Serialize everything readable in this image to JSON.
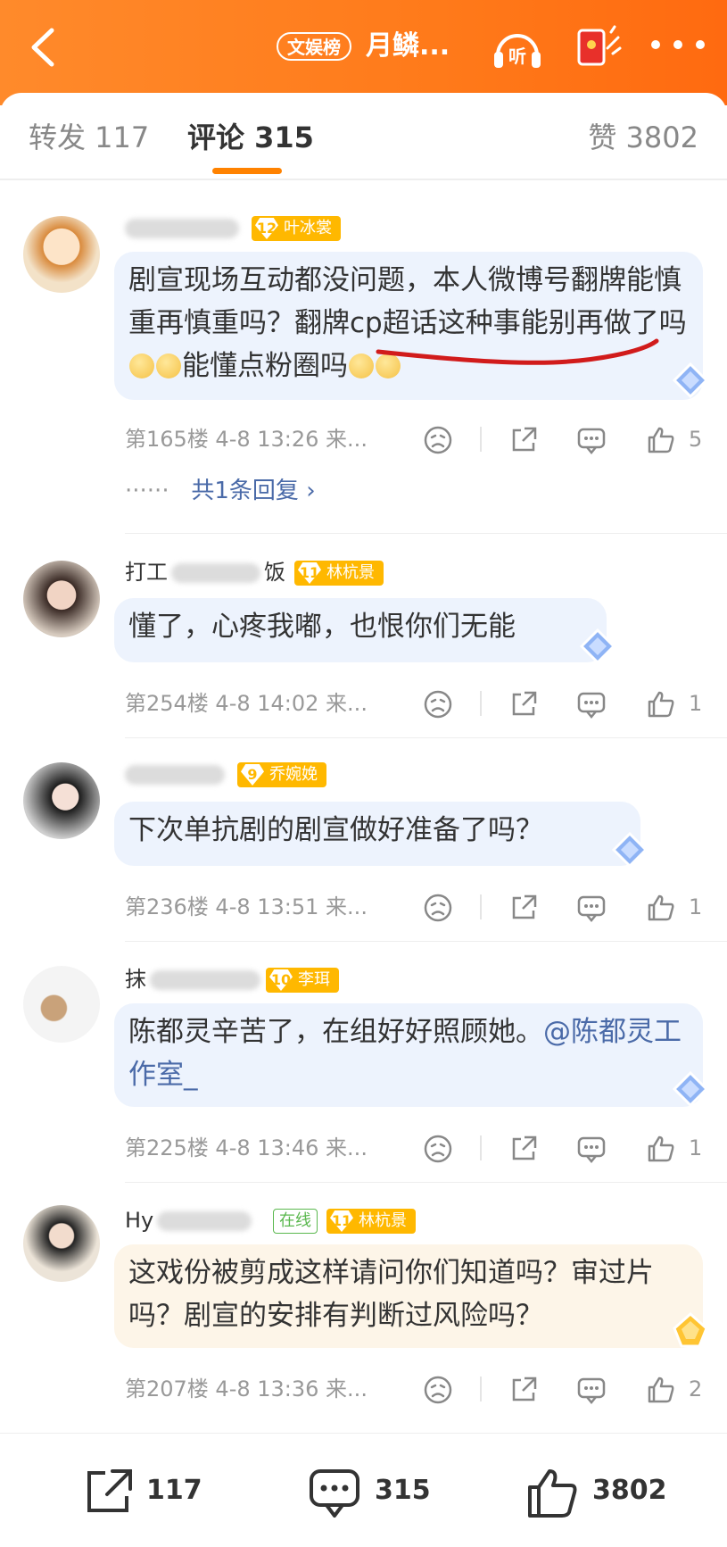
{
  "header": {
    "badge": "文娱榜",
    "title": "月鳞...",
    "listen_label": "听"
  },
  "tabs": [
    {
      "label": "转发 117"
    },
    {
      "label": "评论 315"
    },
    {
      "label": "赞 3802"
    }
  ],
  "comments": [
    {
      "name_visible": "",
      "level": "12",
      "level_name": "叶冰裳",
      "text_a": "剧宣现场互动都没问题，本人微博号翻牌能慎重再慎重吗？翻牌cp超话这种事能别再做了吗",
      "text_b": "能懂点粉圈吗",
      "meta": "第165楼 4-8 13:26 来...",
      "likes": "5",
      "reply_more": "共1条回复"
    },
    {
      "name_visible": "打工",
      "name_tail": "饭",
      "level": "11",
      "level_name": "林杭景",
      "text": "懂了，心疼我嘟，也恨你们无能",
      "meta": "第254楼 4-8 14:02 来...",
      "likes": "1"
    },
    {
      "name_visible": "",
      "level": "9",
      "level_name": "乔婉娩",
      "text": "下次单抗剧的剧宣做好准备了吗？",
      "meta": "第236楼 4-8 13:51 来...",
      "likes": "1"
    },
    {
      "name_visible": "抹",
      "level": "10",
      "level_name": "李珥",
      "text": "陈都灵辛苦了，在组好好照顾她。",
      "mention": "@陈都灵工作室_",
      "meta": "第225楼 4-8 13:46 来...",
      "likes": "1"
    },
    {
      "name_visible": "Hy",
      "online": "在线",
      "level": "11",
      "level_name": "林杭景",
      "text": "这戏份被剪成这样请问你们知道吗？审过片吗？剧宣的安排有判断过风险吗？",
      "meta": "第207楼 4-8 13:36 来...",
      "likes": "2"
    }
  ],
  "bottom_bar": {
    "reposts": "117",
    "comments": "315",
    "likes": "3802"
  },
  "colors": {
    "accent": "#ff8200",
    "header_bg": "#ff7a1a",
    "link": "#4a6aa8",
    "level_badge": "#ffb800",
    "online": "#5bb84f"
  }
}
